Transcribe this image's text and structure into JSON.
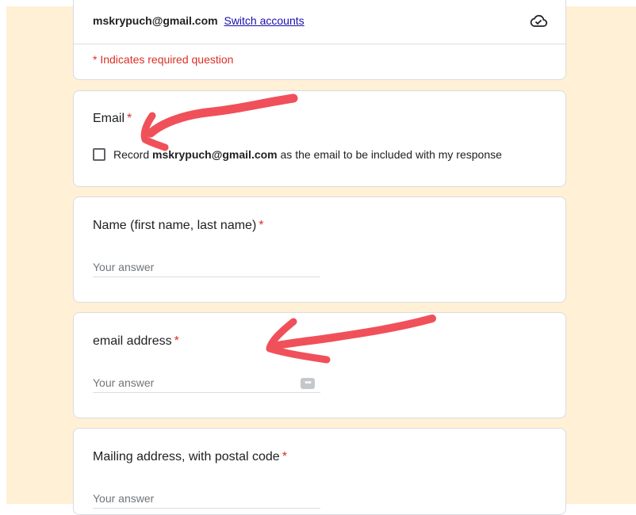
{
  "header": {
    "account_email": "mskrypuch@gmail.com",
    "switch_accounts": "Switch accounts",
    "cloud_icon": "cloud-check-icon",
    "required_note": "* Indicates required question"
  },
  "questions": [
    {
      "title": "Email",
      "required_mark": "*",
      "checkbox": {
        "prefix": "Record ",
        "email": "mskrypuch@gmail.com",
        "suffix": " as the email to be included with my response",
        "checked": false
      }
    },
    {
      "title": "Name (first name, last name)",
      "required_mark": "*",
      "placeholder": "Your answer"
    },
    {
      "title": "email address",
      "required_mark": "*",
      "placeholder": "Your answer",
      "autofill_icon": "password-manager-icon"
    },
    {
      "title": "Mailing address, with postal code",
      "required_mark": "*",
      "placeholder": "Your answer"
    }
  ],
  "annotation_color": "#f0505a"
}
